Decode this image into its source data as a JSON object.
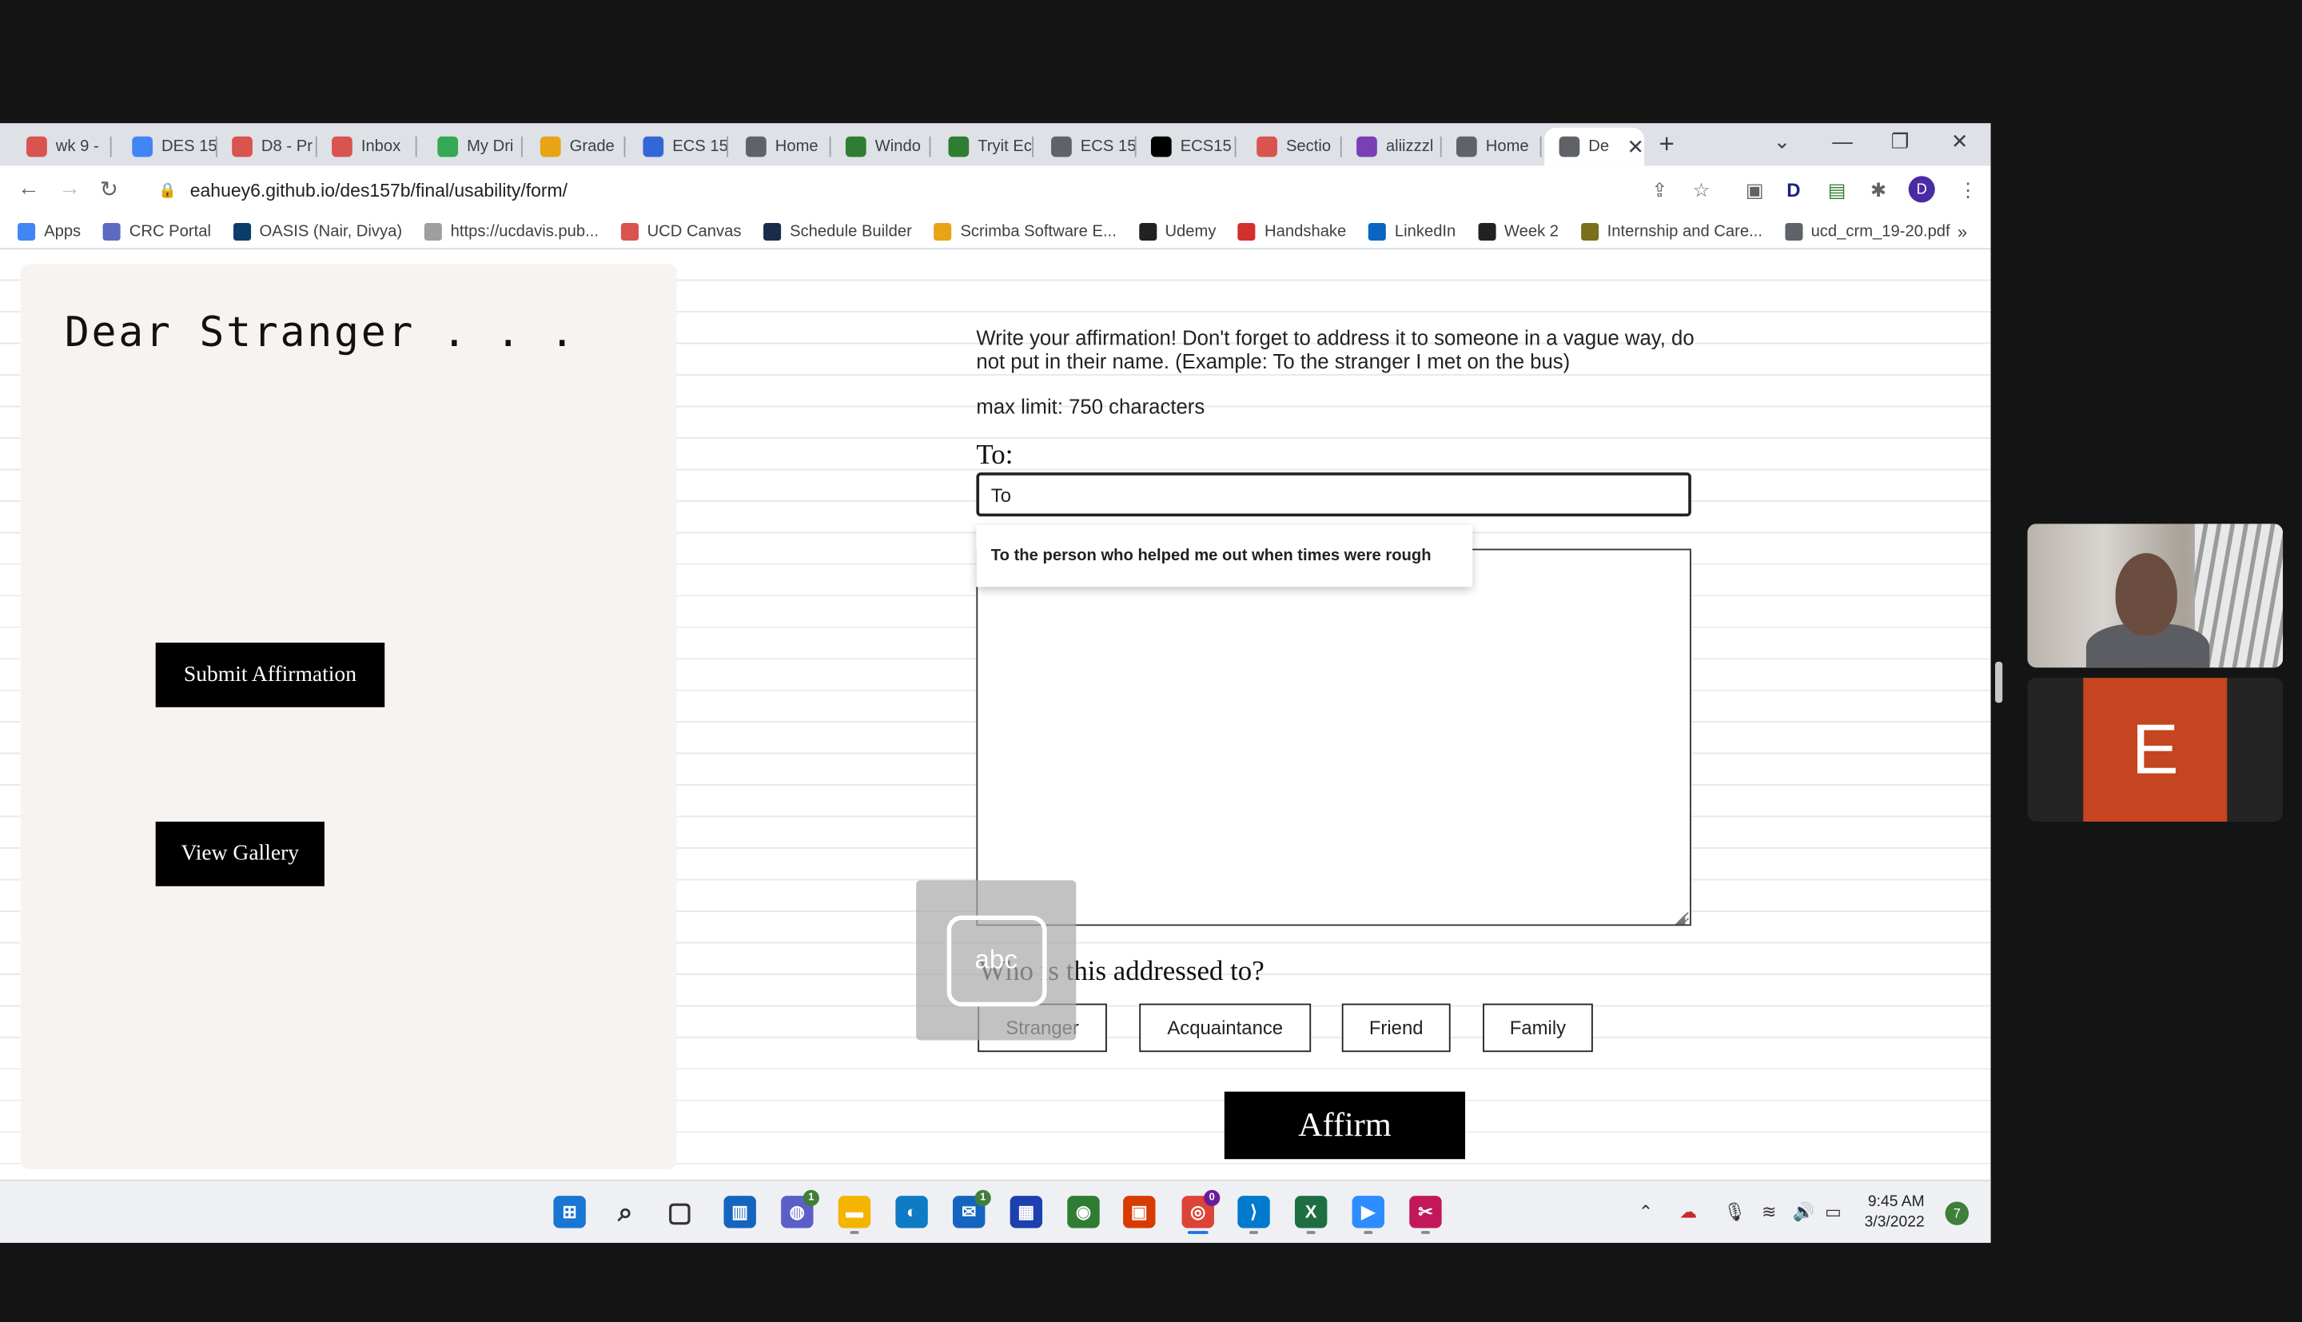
{
  "browser": {
    "tabs": [
      {
        "title": "wk 9 -",
        "icon_color": "#d9534f"
      },
      {
        "title": "DES 15",
        "icon_color": "#4285f4"
      },
      {
        "title": "D8 - Pr",
        "icon_color": "#d9534f"
      },
      {
        "title": "Inbox",
        "icon_color": "#d9534f"
      },
      {
        "title": "My Dri",
        "icon_color": "#34a853"
      },
      {
        "title": "Grade",
        "icon_color": "#e8a317"
      },
      {
        "title": "ECS 15",
        "icon_color": "#3367d6"
      },
      {
        "title": "Home",
        "icon_color": "#5f6368"
      },
      {
        "title": "Windo",
        "icon_color": "#2e7d32"
      },
      {
        "title": "Tryit Ec",
        "icon_color": "#2e7d32"
      },
      {
        "title": "ECS 15",
        "icon_color": "#5f6368"
      },
      {
        "title": "ECS15",
        "icon_color": "#000000"
      },
      {
        "title": "Sectio",
        "icon_color": "#d9534f"
      },
      {
        "title": "aliizzzl",
        "icon_color": "#7b3fb5"
      },
      {
        "title": "Home",
        "icon_color": "#5f6368"
      },
      {
        "title": "De",
        "icon_color": "#5f6368"
      }
    ],
    "url": "eahuey6.github.io/des157b/final/usability/form/",
    "bookmarks": [
      {
        "label": "Apps",
        "color": "#4285f4"
      },
      {
        "label": "CRC Portal",
        "color": "#5c6bc0"
      },
      {
        "label": "OASIS (Nair, Divya)",
        "color": "#0b3d6b"
      },
      {
        "label": "https://ucdavis.pub...",
        "color": "#9e9e9e"
      },
      {
        "label": "UCD Canvas",
        "color": "#d9534f"
      },
      {
        "label": "Schedule Builder",
        "color": "#1a2b4c"
      },
      {
        "label": "Scrimba Software E...",
        "color": "#e8a317"
      },
      {
        "label": "Udemy",
        "color": "#222222"
      },
      {
        "label": "Handshake",
        "color": "#d32f2f"
      },
      {
        "label": "LinkedIn",
        "color": "#0a66c2"
      },
      {
        "label": "Week 2",
        "color": "#222222"
      },
      {
        "label": "Internship and Care...",
        "color": "#7a6f1c"
      },
      {
        "label": "ucd_crm_19-20.pdf",
        "color": "#5f6368"
      }
    ]
  },
  "page": {
    "title": "Dear Stranger . . .",
    "submit_label": "Submit Affirmation",
    "gallery_label": "View Gallery",
    "instructions": "Write your affirmation! Don't forget to address it to someone in a vague way, do not put in their name. (Example: To the stranger I met on the bus)",
    "max_limit": "max limit: 750 characters",
    "to_label": "To:",
    "to_value": "To",
    "autocomplete_suggestion": "To the person who helped me out when times were rough",
    "who_label": "Who is this addressed to?",
    "categories": [
      "Stranger",
      "Acquaintance",
      "Friend",
      "Family"
    ],
    "affirm_label": "Affirm",
    "ime_label": "abc"
  },
  "taskbar": {
    "time": "9:45 AM",
    "date": "3/3/2022",
    "notifications": "7",
    "apps": [
      {
        "name": "windows-start-icon",
        "color": "#1976d2"
      },
      {
        "name": "search-icon",
        "color": "#333333"
      },
      {
        "name": "task-view-icon",
        "color": "#333333"
      },
      {
        "name": "widgets-icon",
        "color": "#1565c0"
      },
      {
        "name": "teams-chat-icon",
        "color": "#5b5fc7"
      },
      {
        "name": "file-explorer-icon",
        "color": "#f4b400"
      },
      {
        "name": "edge-icon",
        "color": "#0f7bc4"
      },
      {
        "name": "mail-icon",
        "color": "#1565c0"
      },
      {
        "name": "store-icon",
        "color": "#1e40af"
      },
      {
        "name": "app-green-icon",
        "color": "#2e7d32"
      },
      {
        "name": "office-icon",
        "color": "#d83b01"
      },
      {
        "name": "chrome-icon",
        "color": "#db4437"
      },
      {
        "name": "vscode-icon",
        "color": "#007acc"
      },
      {
        "name": "excel-icon",
        "color": "#1d6f42"
      },
      {
        "name": "zoom-icon",
        "color": "#2d8cff"
      },
      {
        "name": "snipping-tool-icon",
        "color": "#c2185b"
      }
    ]
  },
  "meeting": {
    "participant_initial": "E",
    "tile_color": "#c4451f"
  }
}
